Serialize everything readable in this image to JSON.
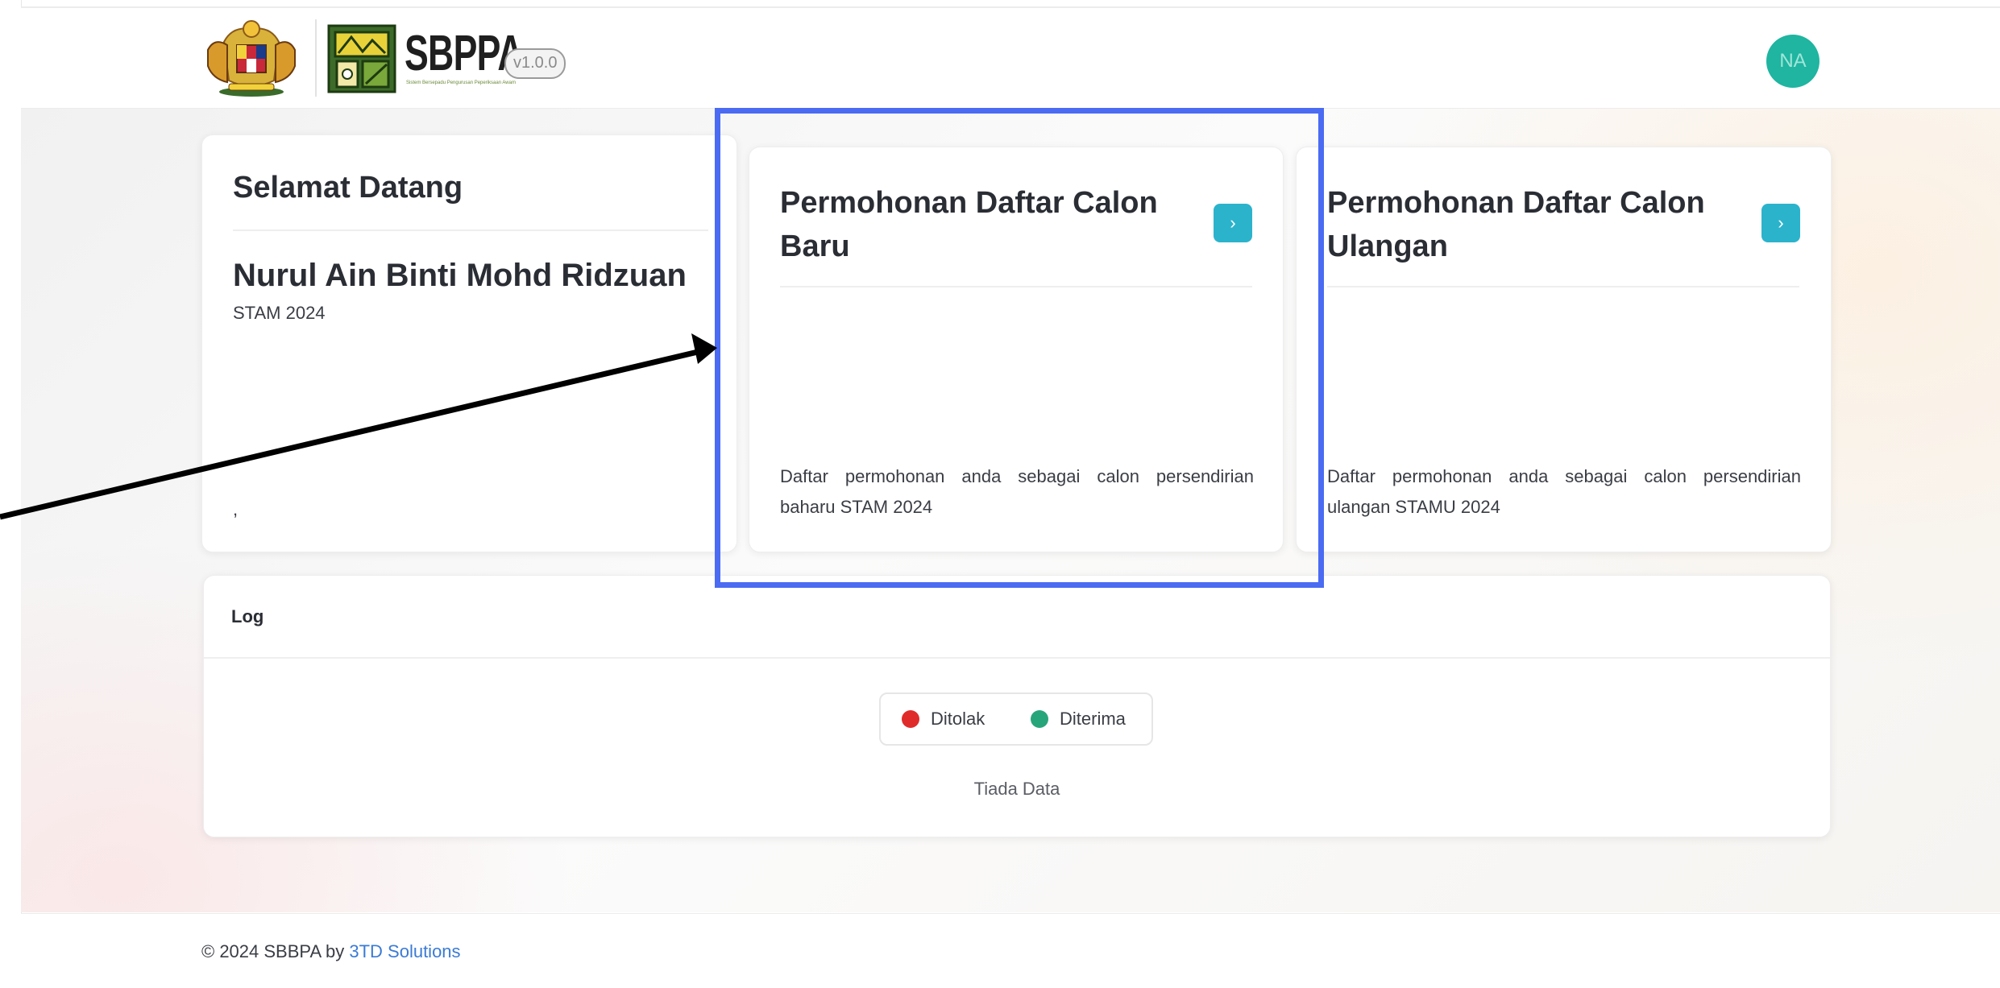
{
  "header": {
    "brand_name": "SBPPA",
    "brand_subtitle": "Sistem Bersepadu Pengurusan Peperiksaan Awam",
    "version": "v1.0.0",
    "avatar_initials": "NA"
  },
  "welcome": {
    "title": "Selamat Datang",
    "user_name": "Nurul Ain Binti Mohd Ridzuan",
    "exam": "STAM 2024",
    "footer_text": ","
  },
  "applications": [
    {
      "title": "Permohonan Daftar Calon Baru",
      "description": "Daftar permohonan anda sebagai calon persendirian baharu STAM 2024",
      "button_icon": "chevron-right-icon",
      "button_glyph": "›"
    },
    {
      "title": "Permohonan Daftar Calon Ulangan",
      "description": "Daftar permohonan anda sebagai calon persendirian ulangan STAMU 2024",
      "button_icon": "chevron-right-icon",
      "button_glyph": "›"
    }
  ],
  "log": {
    "title": "Log",
    "legend": [
      {
        "label": "Ditolak",
        "color": "#e02b2b"
      },
      {
        "label": "Diterima",
        "color": "#27a57a"
      }
    ],
    "empty_text": "Tiada Data"
  },
  "footer": {
    "copyright": "© 2024 SBBPA by ",
    "link_text": "3TD Solutions"
  },
  "colors": {
    "accent": "#2bb3cc",
    "avatar": "#1fb5a0",
    "highlight": "#4a6bf2"
  }
}
